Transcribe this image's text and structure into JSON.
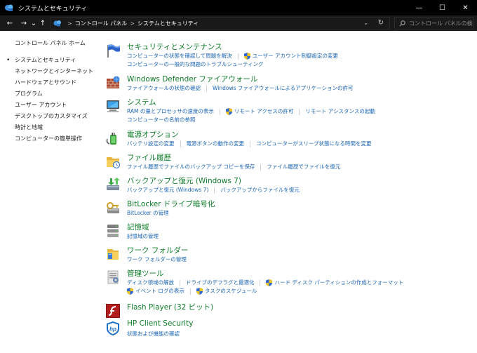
{
  "window": {
    "title": "システムとセキュリティ",
    "minimize": "—",
    "maximize": "☐",
    "close": "✕"
  },
  "address": {
    "back": "←",
    "forward": "→",
    "recent": "⌄",
    "up": "↑",
    "crumbs": [
      "コントロール パネル",
      "システムとセキュリティ"
    ],
    "separator": ">",
    "dropdown": "⌄",
    "refresh": "↻",
    "search_placeholder": "コントロール パネルの検索"
  },
  "sidebar": {
    "home": "コントロール パネル ホーム",
    "items": [
      {
        "label": "システムとセキュリティ",
        "current": true
      },
      {
        "label": "ネットワークとインターネット"
      },
      {
        "label": "ハードウェアとサウンド"
      },
      {
        "label": "プログラム"
      },
      {
        "label": "ユーザー アカウント"
      },
      {
        "label": "デスクトップのカスタマイズ"
      },
      {
        "label": "時計と地域"
      },
      {
        "label": "コンピューターの簡単操作"
      }
    ]
  },
  "categories": [
    {
      "title": "セキュリティとメンテナンス",
      "icon": "flag-icon",
      "rows": [
        [
          "コンピューターの状態を確認して問題を解決",
          "ユーザー アカウント制御設定の変更"
        ],
        [
          "コンピューターの一般的な問題のトラブルシューティング"
        ]
      ]
    },
    {
      "title": "Windows Defender ファイアウォール",
      "icon": "firewall-icon",
      "rows": [
        [
          "ファイアウォールの状態の確認",
          "Windows ファイアウォールによるアプリケーションの許可"
        ]
      ]
    },
    {
      "title": "システム",
      "icon": "computer-icon",
      "rows": [
        [
          "RAM の量とプロセッサの速度の表示",
          "リモート アクセスの許可",
          "リモート アシスタンスの起動"
        ],
        [
          "コンピューターの名前の参照"
        ]
      ]
    },
    {
      "title": "電源オプション",
      "icon": "power-icon",
      "rows": [
        [
          "バッテリ設定の変更",
          "電源ボタンの動作の変更",
          "コンピューターがスリープ状態になる時間を変更"
        ]
      ]
    },
    {
      "title": "ファイル履歴",
      "icon": "file-history-icon",
      "rows": [
        [
          "ファイル履歴でファイルのバックアップ コピーを保存",
          "ファイル履歴でファイルを復元"
        ]
      ]
    },
    {
      "title": "バックアップと復元 (Windows 7)",
      "icon": "backup-icon",
      "rows": [
        [
          "バックアップと復元 (Windows 7)",
          "バックアップからファイルを復元"
        ]
      ]
    },
    {
      "title": "BitLocker ドライブ暗号化",
      "icon": "bitlocker-icon",
      "rows": [
        [
          "BitLocker の管理"
        ]
      ]
    },
    {
      "title": "記憶域",
      "icon": "storage-icon",
      "rows": [
        [
          "記憶域の管理"
        ]
      ]
    },
    {
      "title": "ワーク フォルダー",
      "icon": "work-folders-icon",
      "rows": [
        [
          "ワーク フォルダーの管理"
        ]
      ]
    },
    {
      "title": "管理ツール",
      "icon": "admin-tools-icon",
      "rows": [
        [
          "ディスク領域の解放",
          "ドライブのデフラグと最適化",
          "ハード ディスク パーティションの作成とフォーマット"
        ],
        [
          "イベント ログの表示",
          "タスクのスケジュール"
        ]
      ]
    },
    {
      "title": "Flash Player (32 ビット)",
      "icon": "flash-icon",
      "rows": []
    },
    {
      "title": "HP Client Security",
      "icon": "hp-security-icon",
      "rows": [
        [
          "状態および機能の確認"
        ]
      ]
    }
  ],
  "colors": {
    "category_title": "#0e7b28",
    "link": "#1a64b4",
    "titlebar": "#000000"
  }
}
